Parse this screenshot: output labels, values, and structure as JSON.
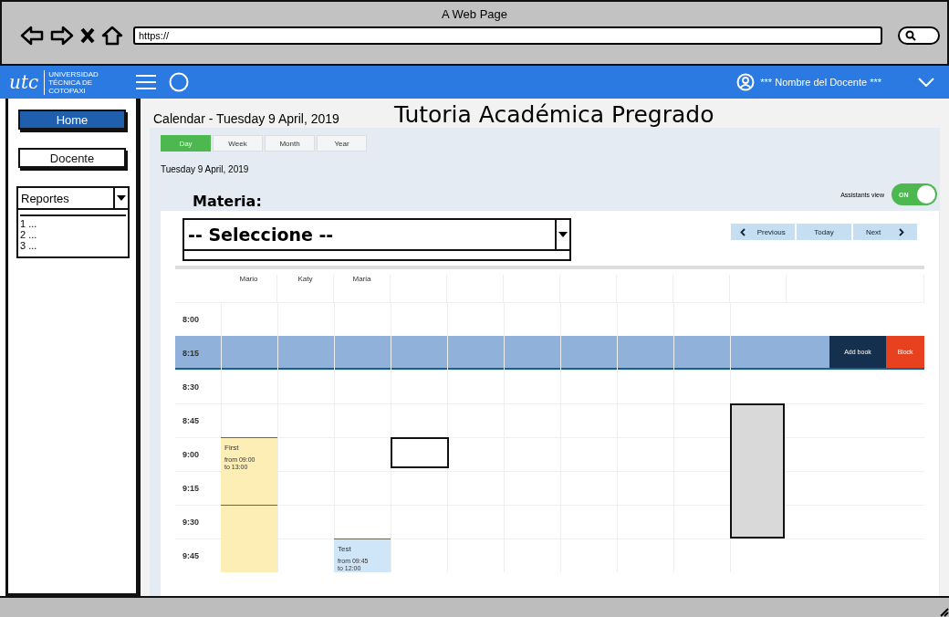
{
  "browser": {
    "title": "A Web Page",
    "url": "https://"
  },
  "header": {
    "logo_mark": "utc",
    "logo_lines": [
      "UNIVERSIDAD",
      "TÉCNICA DE",
      "COTOPAXI"
    ],
    "user_name": "*** Nombre del Docente ***"
  },
  "sidebar": {
    "buttons": [
      {
        "label": "Home",
        "selected": true
      },
      {
        "label": "Docente",
        "selected": false
      }
    ],
    "reports": {
      "value": "Reportes",
      "items": [
        "1 ...",
        "2 ...",
        "3 ..."
      ]
    }
  },
  "main": {
    "calendar_title": "Calendar - Tuesday 9 April, 2019",
    "app_title": "Tutoria Académica Pregrado",
    "view_tabs": [
      {
        "label": "Day",
        "selected": true
      },
      {
        "label": "Week",
        "selected": false
      },
      {
        "label": "Month",
        "selected": false
      },
      {
        "label": "Year",
        "selected": false
      }
    ],
    "date": "Tuesday 9 April, 2019",
    "assistants_view": {
      "label": "Assistants view",
      "on": true,
      "state_label": "ON"
    },
    "subject": {
      "label": "Materia:",
      "value": "-- Seleccione --"
    },
    "nav": [
      "Previous",
      "Today",
      "Next"
    ],
    "calendar": {
      "people": [
        "Mario",
        "Katy",
        "Maria"
      ],
      "times": [
        {
          "label": "8:00",
          "selected": false
        },
        {
          "label": "8:15",
          "selected": true
        },
        {
          "label": "8:30",
          "selected": false
        },
        {
          "label": "8:45",
          "selected": false
        },
        {
          "label": "9:00",
          "selected": false
        },
        {
          "label": "9:15",
          "selected": false
        },
        {
          "label": "9:30",
          "selected": false
        },
        {
          "label": "9:45",
          "selected": false
        }
      ],
      "actions": [
        {
          "label": "Add book",
          "kind": "book"
        },
        {
          "label": "Block",
          "kind": "block"
        }
      ],
      "events": [
        {
          "title": "First",
          "lines": [
            "from 09:00",
            "to 13:00"
          ],
          "color": "#fdeeb5"
        },
        {
          "color": "#fdeeb5"
        },
        {
          "title": "Test",
          "lines": [
            "from 09:45",
            "to 12:00"
          ],
          "color": "#cfe6f8"
        }
      ],
      "placeholder_boxes": [
        {
          "kind": "white"
        },
        {
          "kind": "grey"
        }
      ]
    }
  }
}
